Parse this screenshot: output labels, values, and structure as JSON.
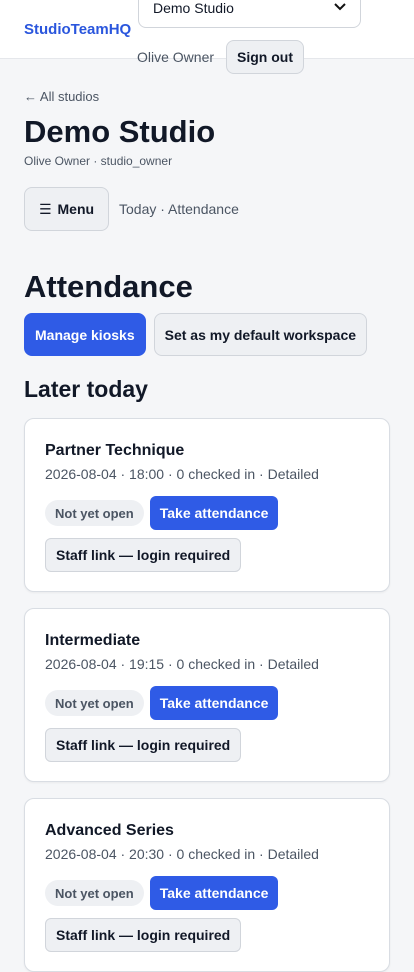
{
  "header": {
    "brand": "StudioTeamHQ",
    "studio_select": "Demo Studio",
    "user_name": "Olive Owner",
    "sign_out": "Sign out"
  },
  "studio": {
    "back_link": "← All studios",
    "name": "Demo Studio",
    "subtitle": "Olive Owner · studio_owner",
    "menu_label": "Menu",
    "menu_icon": "☰",
    "breadcrumb": "Today · Attendance"
  },
  "page": {
    "title": "Attendance",
    "manage_kiosks": "Manage kiosks",
    "set_default": "Set as my default workspace",
    "section_title": "Later today"
  },
  "classes": [
    {
      "name": "Partner Technique",
      "meta": "2026-08-04 · 18:00 · 0 checked in · Detailed",
      "status": "Not yet open",
      "take_attendance": "Take attendance",
      "staff_link": "Staff link — login required"
    },
    {
      "name": "Intermediate",
      "meta": "2026-08-04 · 19:15 · 0 checked in · Detailed",
      "status": "Not yet open",
      "take_attendance": "Take attendance",
      "staff_link": "Staff link — login required"
    },
    {
      "name": "Advanced Series",
      "meta": "2026-08-04 · 20:30 · 0 checked in · Detailed",
      "status": "Not yet open",
      "take_attendance": "Take attendance",
      "staff_link": "Staff link — login required"
    }
  ]
}
